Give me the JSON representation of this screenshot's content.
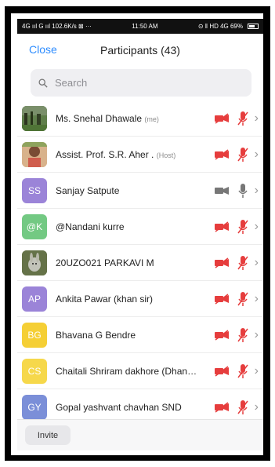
{
  "status_bar": {
    "left": "4G ııl G ııl 102.6K/s ⊠ ···",
    "time": "11:50 AM",
    "right": "⊙ ‖ HD 4G 69%"
  },
  "header": {
    "close_label": "Close",
    "title": "Participants (43)"
  },
  "search": {
    "placeholder": "Search"
  },
  "participants": [
    {
      "name": "Ms. Snehal Dhawale",
      "tag": "(me)",
      "initials": "",
      "avatar_color": "#4b6e3c",
      "avatar_type": "photo",
      "camera": "off",
      "mic": "off"
    },
    {
      "name": "Assist. Prof. S.R. Aher .",
      "tag": "(Host)",
      "initials": "",
      "avatar_color": "#d7a27b",
      "avatar_type": "photo",
      "camera": "off",
      "mic": "off"
    },
    {
      "name": "Sanjay Satpute",
      "tag": "",
      "initials": "SS",
      "avatar_color": "#9b84d8",
      "avatar_type": "initials",
      "camera": "on",
      "mic": "on"
    },
    {
      "name": "@Nandani kurre",
      "tag": "",
      "initials": "@K",
      "avatar_color": "#73c983",
      "avatar_type": "initials",
      "camera": "off",
      "mic": "off"
    },
    {
      "name": "20UZO021 PARKAVI M",
      "tag": "",
      "initials": "",
      "avatar_color": "#617148",
      "avatar_type": "photo",
      "camera": "off",
      "mic": "off"
    },
    {
      "name": "Ankita Pawar (khan sir)",
      "tag": "",
      "initials": "AP",
      "avatar_color": "#9b84d8",
      "avatar_type": "initials",
      "camera": "off",
      "mic": "off"
    },
    {
      "name": "Bhavana G Bendre",
      "tag": "",
      "initials": "BG",
      "avatar_color": "#f5cf35",
      "avatar_type": "initials",
      "camera": "off",
      "mic": "off"
    },
    {
      "name": "Chaitali Shriram dakhore (Dhanwate)",
      "tag": "",
      "initials": "CS",
      "avatar_color": "#f6d84b",
      "avatar_type": "initials",
      "camera": "off",
      "mic": "off"
    },
    {
      "name": "Gopal yashvant chavhan SND",
      "tag": "",
      "initials": "GY",
      "avatar_color": "#7b8fd8",
      "avatar_type": "initials",
      "camera": "off",
      "mic": "off"
    }
  ],
  "footer": {
    "invite_label": "Invite"
  },
  "colors": {
    "accent": "#2d8cff",
    "muted_red": "#e63d3d",
    "gray": "#8c8c8c"
  }
}
